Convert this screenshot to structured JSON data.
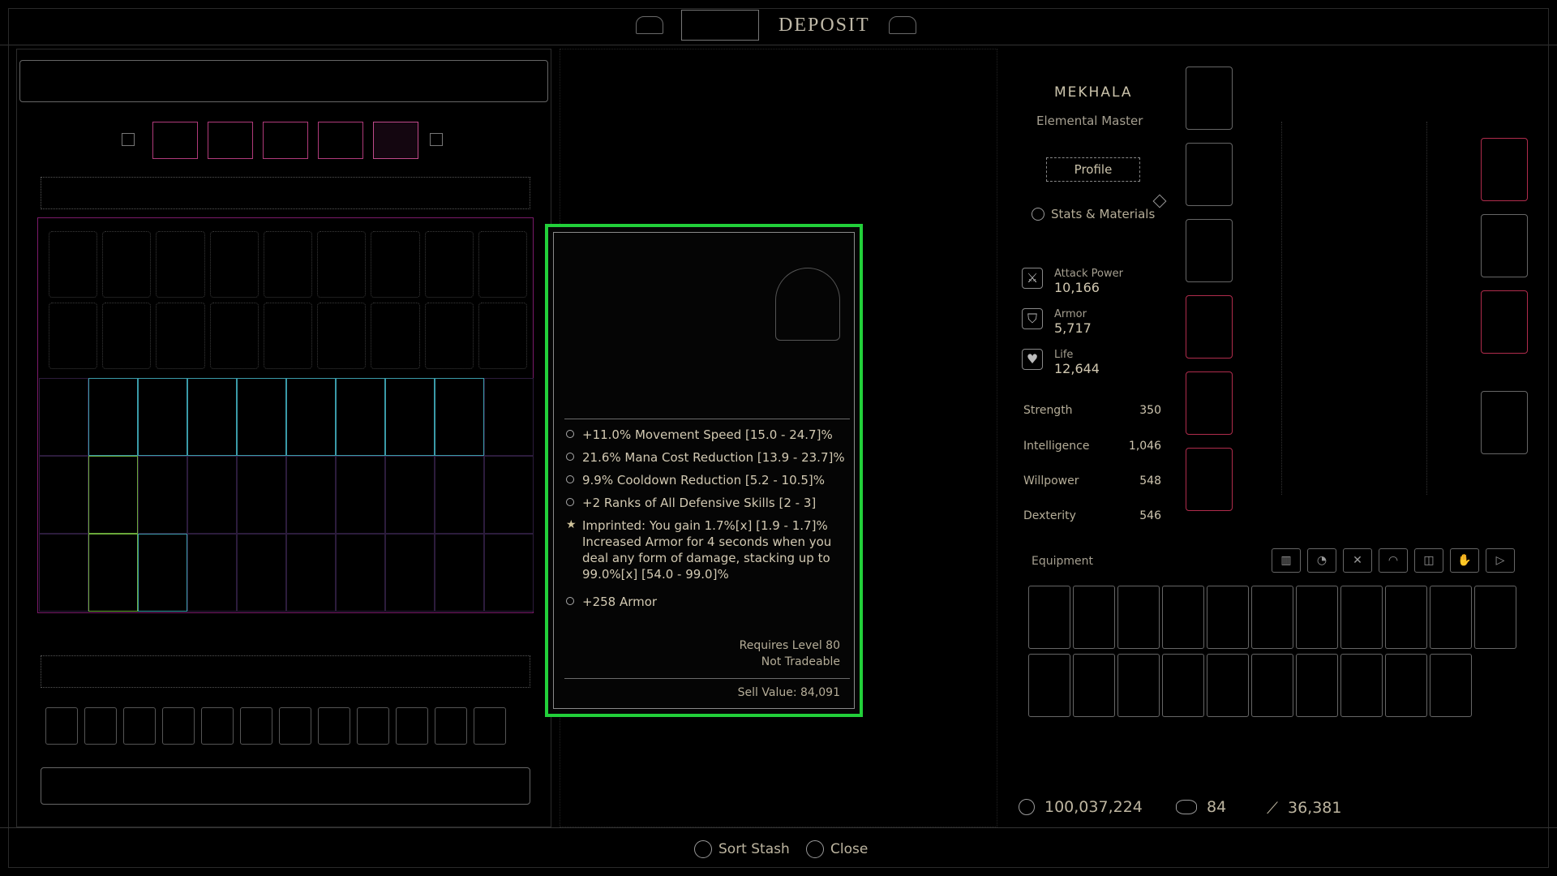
{
  "header": {
    "title": "DEPOSIT"
  },
  "stash": {
    "tabs": [
      "",
      "",
      "",
      "",
      "",
      ""
    ],
    "sort_label": "",
    "hotbar_count": 12
  },
  "tooltip": {
    "item_type": "",
    "item_name": "",
    "affixes": [
      {
        "text": "+11.0% Movement Speed [15.0 - 24.7]%",
        "bullet": "circle"
      },
      {
        "text": "21.6% Mana Cost Reduction [13.9 - 23.7]%",
        "bullet": "circle"
      },
      {
        "text": "9.9% Cooldown Reduction [5.2 - 10.5]%",
        "bullet": "circle"
      },
      {
        "text": "+2 Ranks of All Defensive Skills [2 - 3]",
        "bullet": "circle"
      },
      {
        "text": "Imprinted: You gain 1.7%[x] [1.9 - 1.7]% Increased Armor for 4 seconds when you deal any form of damage, stacking up to 99.0%[x] [54.0 - 99.0]%",
        "bullet": "star"
      },
      {
        "text": "+258 Armor",
        "bullet": "circle"
      }
    ],
    "requires_level": "Requires Level 80",
    "tradeable": "Not Tradeable",
    "sell_value": "Sell Value: 84,091"
  },
  "character": {
    "name": "MEKHALA",
    "class": "Elemental Master",
    "profile_button": "Profile",
    "stats_link": "Stats & Materials",
    "core_stats": [
      {
        "label": "Attack Power",
        "value": "10,166",
        "icon": "sword-icon"
      },
      {
        "label": "Armor",
        "value": "5,717",
        "icon": "shield-icon"
      },
      {
        "label": "Life",
        "value": "12,644",
        "icon": "heart-icon"
      }
    ],
    "attributes": [
      {
        "label": "Strength",
        "value": "350"
      },
      {
        "label": "Intelligence",
        "value": "1,046"
      },
      {
        "label": "Willpower",
        "value": "548"
      },
      {
        "label": "Dexterity",
        "value": "546"
      }
    ]
  },
  "equipment": {
    "label": "Equipment"
  },
  "currency": {
    "gold": "100,037,224",
    "obols": "84",
    "red_dust": "36,381"
  },
  "bottom": {
    "sort_stash": "Sort Stash",
    "close": "Close"
  }
}
